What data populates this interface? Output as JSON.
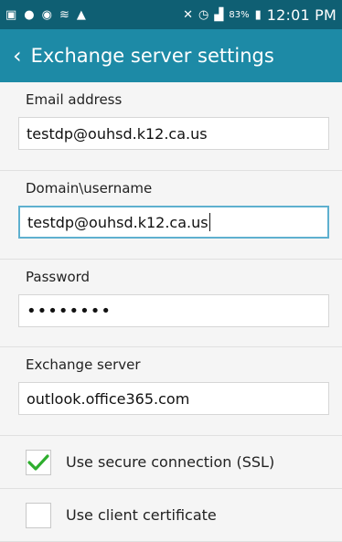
{
  "status_bar": {
    "battery": "83%",
    "time": "12:01 PM",
    "icons": [
      "status-icon-1",
      "status-icon-2",
      "status-icon-3",
      "wifi-icon",
      "alert-icon",
      "signal-icon",
      "battery-icon"
    ]
  },
  "header": {
    "title": "Exchange server settings"
  },
  "form": {
    "email": {
      "label": "Email address",
      "value": "testdp@ouhsd.k12.ca.us"
    },
    "domain_username": {
      "label": "Domain\\username",
      "value": "testdp@ouhsd.k12.ca.us"
    },
    "password": {
      "label": "Password",
      "value": "••••••••"
    },
    "server": {
      "label": "Exchange server",
      "value": "outlook.office365.com"
    }
  },
  "options": {
    "ssl": {
      "label": "Use secure connection (SSL)",
      "checked": true
    },
    "client_cert": {
      "label": "Use client certificate",
      "checked": false
    }
  },
  "colors": {
    "status_bar": "#0f5f73",
    "action_bar": "#1d8aa6",
    "check_green": "#2eae2e",
    "focus_border": "#5eb0cf"
  }
}
